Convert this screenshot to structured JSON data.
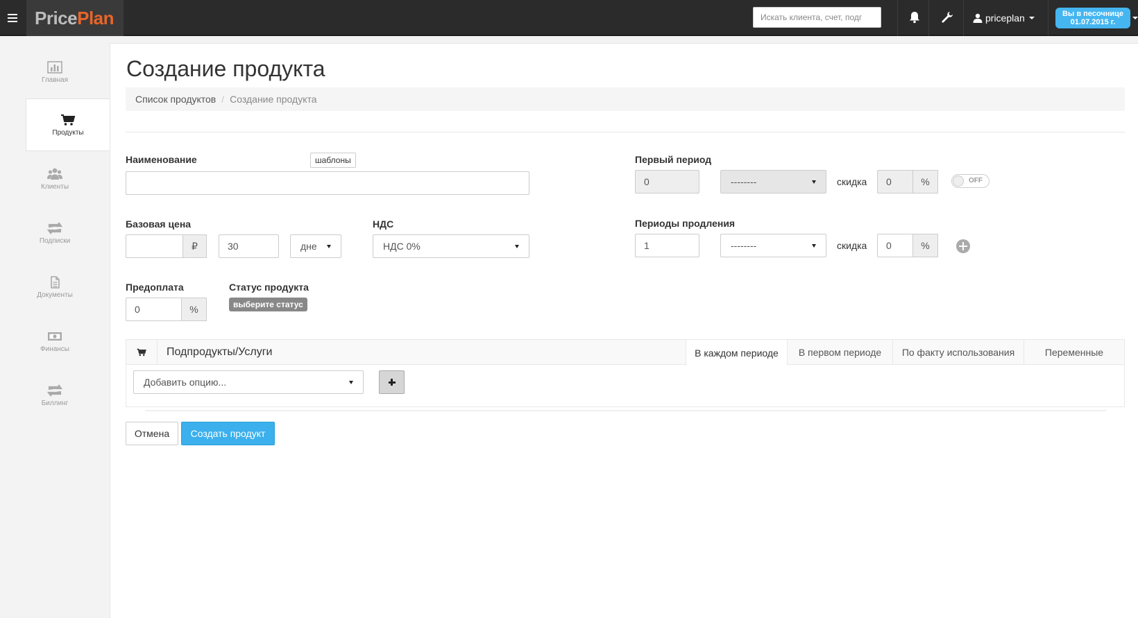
{
  "topbar": {
    "logo_part1": "Price",
    "logo_part2": "Plan",
    "search_placeholder": "Искать клиента, счет, подг",
    "username": "priceplan",
    "sandbox_line1": "Вы в песочнице",
    "sandbox_line2": "01.07.2015 г."
  },
  "sidebar": {
    "items": [
      {
        "label": "Главная",
        "icon": "bar-chart-icon"
      },
      {
        "label": "Продукты",
        "icon": "cart-icon"
      },
      {
        "label": "Клиенты",
        "icon": "users-icon"
      },
      {
        "label": "Подписки",
        "icon": "retweet-icon"
      },
      {
        "label": "Документы",
        "icon": "document-icon"
      },
      {
        "label": "Финансы",
        "icon": "money-icon"
      },
      {
        "label": "Биллинг",
        "icon": "retweet-icon"
      }
    ],
    "active_index": 1
  },
  "page": {
    "title": "Создание продукта",
    "breadcrumb": {
      "parent": "Список продуктов",
      "current": "Создание продукта"
    }
  },
  "form": {
    "name_label": "Наименование",
    "templates_button": "шаблоны",
    "name_value": "",
    "base_price_label": "Базовая цена",
    "base_price_value": "",
    "currency_symbol": "₽",
    "period_count": "30",
    "period_unit": "дне",
    "vat_label": "НДС",
    "vat_value": "НДС 0%",
    "prepay_label": "Предоплата",
    "prepay_value": "0",
    "percent": "%",
    "status_label": "Статус продукта",
    "status_badge": "выберите статус",
    "first_period_label": "Первый период",
    "first_period_value": "0",
    "first_period_unit": "--------",
    "discount_label": "скидка",
    "first_discount": "0",
    "toggle_label": "OFF",
    "renewal_label": "Периоды продления",
    "renewal_value": "1",
    "renewal_unit": "--------",
    "renewal_discount": "0"
  },
  "subproducts": {
    "title": "Подпродукты/Услуги",
    "tabs": [
      "В каждом периоде",
      "В первом периоде",
      "По факту использования",
      "Переменные"
    ],
    "active_tab": 0,
    "add_option_placeholder": "Добавить опцию..."
  },
  "actions": {
    "cancel": "Отмена",
    "create": "Создать продукт"
  },
  "colors": {
    "topbar_bg": "#2b2b2b",
    "accent": "#3bb0ec",
    "logo_orange": "#e8652a"
  }
}
